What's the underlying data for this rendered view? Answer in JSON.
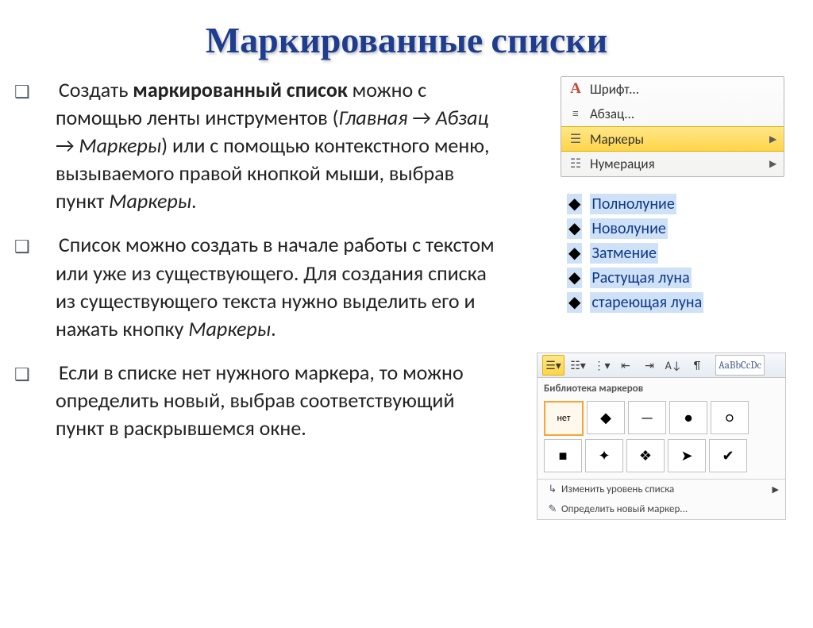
{
  "title": "Маркированные списки",
  "para1": {
    "pre": "Создать ",
    "bold": "маркированный список",
    "mid1": " можно с помощью  ленты инструментов (",
    "i1": "Главная",
    "arrow1": " → ",
    "i2": "Абзац",
    "arrow2": " →  ",
    "i3": "Маркеры",
    "mid2": ") или с помощью контекстного меню, вызываемого правой кнопкой мыши, выбрав пункт ",
    "i4": "Маркеры",
    "end": "."
  },
  "para2": {
    "text1": "Список можно создать в начале работы с текстом или уже из существующего. Для создания  списка из существующего текста нужно выделить его и нажать кнопку ",
    "i1": "Маркеры",
    "end": "."
  },
  "para3": {
    "text": "Если в списке нет нужного маркера, то можно определить новый, выбрав соответствующий пункт в раскрывшемся окне."
  },
  "context_menu": [
    {
      "icon": "A",
      "label": "Шрифт...",
      "selected": false
    },
    {
      "icon": "para",
      "label": "Абзац...",
      "selected": false
    },
    {
      "icon": "bullets",
      "label": "Маркеры",
      "selected": true,
      "arrow": true
    },
    {
      "icon": "numbers",
      "label": "Нумерация",
      "selected": false,
      "arrow": true
    }
  ],
  "example_list": [
    "Полнолуние",
    "Новолуние",
    "Затмение",
    "Растущая луна",
    "стареющая луна"
  ],
  "ribbon": {
    "library_label": "Библиотека маркеров",
    "style_preview": "AaBbCcDc",
    "swatches": [
      "нет",
      "◆",
      "—",
      "●",
      "○",
      "■",
      "✦",
      "❖",
      "➤",
      "✔"
    ],
    "footer1": "Изменить уровень списка",
    "footer2": "Определить новый маркер..."
  }
}
